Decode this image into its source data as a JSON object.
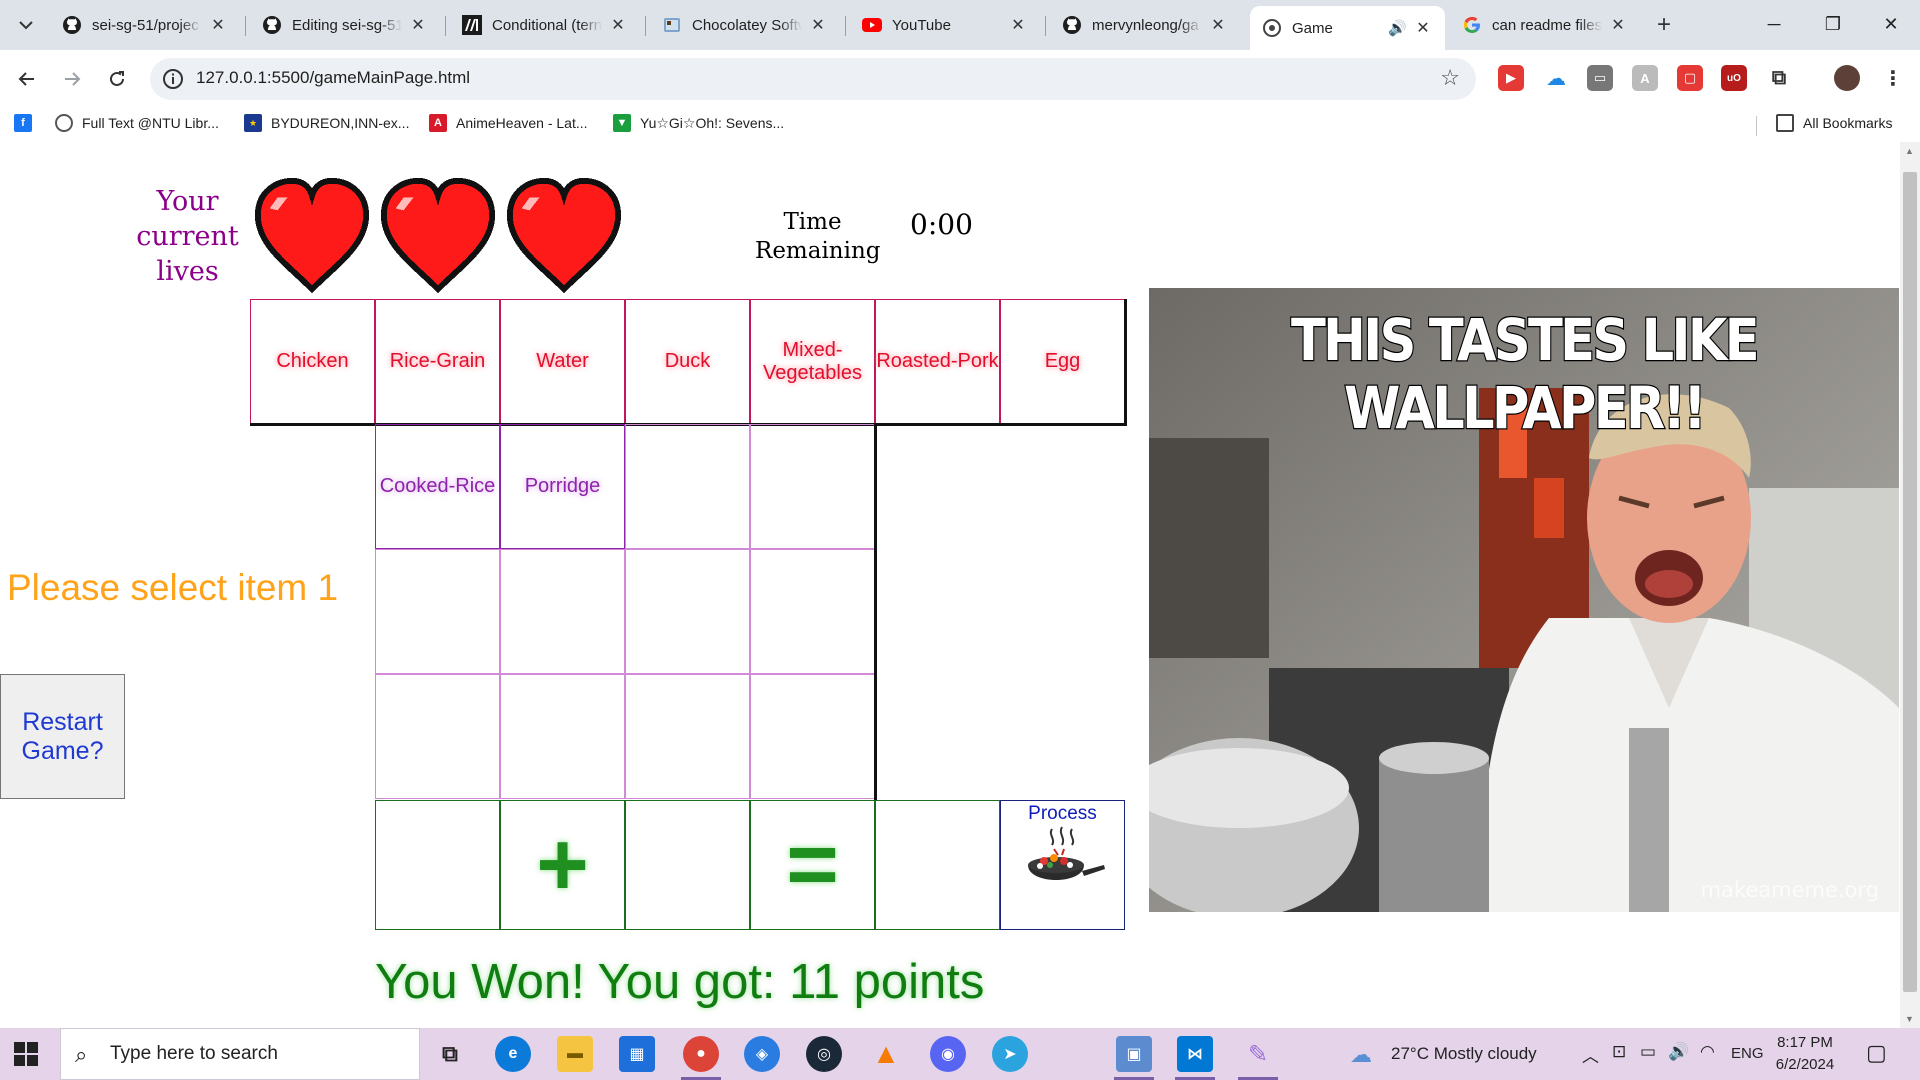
{
  "browser": {
    "tabs": [
      {
        "title": "sei-sg-51/projec",
        "icon": "github-icon"
      },
      {
        "title": "Editing sei-sg-51",
        "icon": "github-icon"
      },
      {
        "title": "Conditional (tern",
        "icon": "mdn-icon"
      },
      {
        "title": "Chocolatey Softw",
        "icon": "chocolatey-icon"
      },
      {
        "title": "YouTube",
        "icon": "youtube-icon"
      },
      {
        "title": "mervynleong/ga",
        "icon": "github-icon"
      },
      {
        "title": "Game",
        "icon": "globe-icon",
        "active": true
      },
      {
        "title": "can readme files",
        "icon": "google-icon"
      }
    ],
    "url": "127.0.0.1:5500/gameMainPage.html",
    "bookmarks": [
      {
        "label": "",
        "icon": "facebook-icon"
      },
      {
        "label": "Full Text @NTU Libr...",
        "icon": "globe-icon"
      },
      {
        "label": "BYDUREON,INN-ex...",
        "icon": "eu-flag-icon"
      },
      {
        "label": "AnimeHeaven - Lat...",
        "icon": "animeheaven-icon"
      },
      {
        "label": "Yu☆Gi☆Oh!: Sevens...",
        "icon": "yugioh-icon"
      }
    ],
    "all_bookmarks": "All Bookmarks",
    "colors": {
      "tabstrip": "#dee3ea",
      "omnibox": "#edf0f4"
    }
  },
  "game": {
    "lives_label": "Your current lives",
    "lives": 3,
    "time_label": "Time Remaining",
    "time_value": "0:00",
    "ingredients": [
      "Chicken",
      "Rice-Grain",
      "Water",
      "Duck",
      "Mixed-Vegetables",
      "Roasted-Pork",
      "Egg"
    ],
    "made_items": [
      "Cooked-Rice",
      "Porridge",
      "",
      "",
      "",
      "",
      "",
      "",
      "",
      "",
      "",
      ""
    ],
    "operators": {
      "plus": "+",
      "equals": "="
    },
    "process_label": "Process",
    "prompt": "Please select item 1",
    "restart_label": "Restart Game?",
    "result": "You Won! You got: 11 points",
    "meme_caption": "THIS TASTES LIKE WALLPAPER!!",
    "meme_watermark": "makeameme.org",
    "colors": {
      "lives_label": "#8b008b",
      "ingredient": "#e0102c",
      "made": "#8e24aa",
      "prompt": "#ffa31a",
      "result": "#0f7d10",
      "restart_text": "#1f3ad1"
    }
  },
  "taskbar": {
    "search_placeholder": "Type here to search",
    "weather": "27°C  Mostly cloudy",
    "language": "ENG",
    "time": "8:17 PM",
    "date": "6/2/2024",
    "colors": {
      "background": "#e5d3ea"
    }
  }
}
